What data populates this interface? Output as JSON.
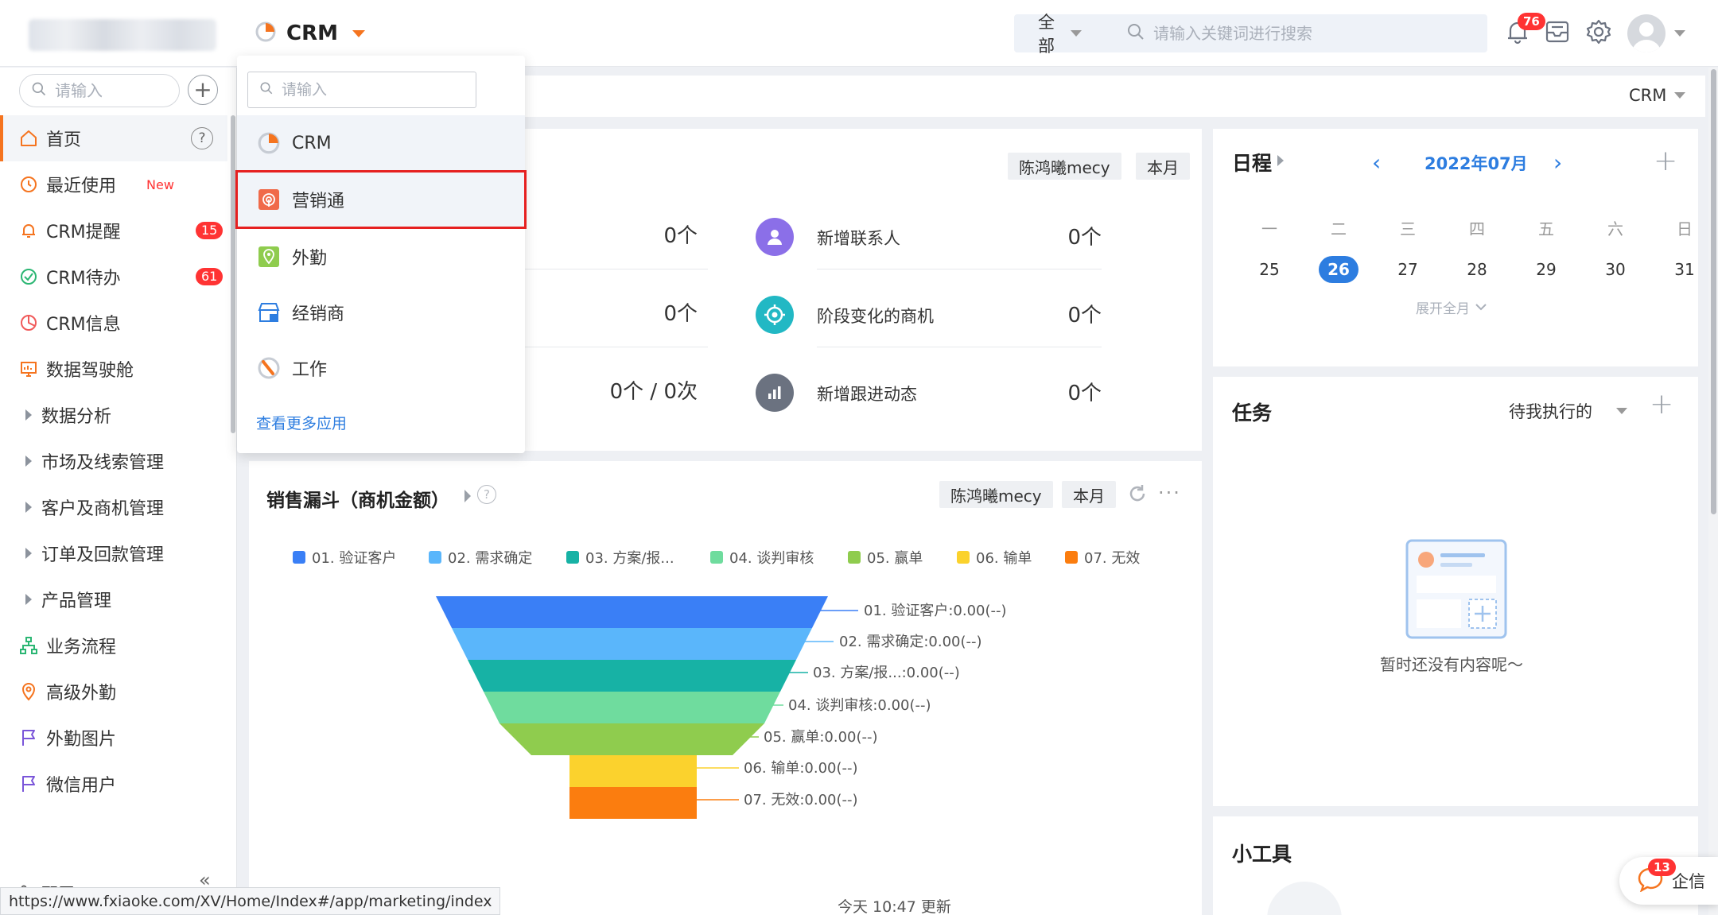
{
  "colors": {
    "brand_orange": "#f5741f",
    "primary_blue": "#2d7de0",
    "badge_red": "#ff3333",
    "highlight_red": "#e62020"
  },
  "topbar": {
    "app_name": "CRM",
    "search_scope": "全部",
    "search_placeholder": "请输入关键词进行搜索",
    "notification_count": "76"
  },
  "sidebar": {
    "search_placeholder": "请输入",
    "items": [
      {
        "label": "首页",
        "icon": "home-icon",
        "active": true
      },
      {
        "label": "最近使用",
        "icon": "clock-icon",
        "tag": "New"
      },
      {
        "label": "CRM提醒",
        "icon": "bell-icon",
        "badge": "15"
      },
      {
        "label": "CRM待办",
        "icon": "check-circle-icon",
        "badge": "61"
      },
      {
        "label": "CRM信息",
        "icon": "pie-icon"
      },
      {
        "label": "数据驾驶舱",
        "icon": "dashboard-icon"
      },
      {
        "label": "数据分析",
        "icon": "expand-arrow-icon"
      },
      {
        "label": "市场及线索管理",
        "icon": "expand-arrow-icon"
      },
      {
        "label": "客户及商机管理",
        "icon": "expand-arrow-icon"
      },
      {
        "label": "订单及回款管理",
        "icon": "expand-arrow-icon"
      },
      {
        "label": "产品管理",
        "icon": "expand-arrow-icon"
      },
      {
        "label": "业务流程",
        "icon": "flow-icon"
      },
      {
        "label": "高级外勤",
        "icon": "location-icon"
      },
      {
        "label": "外勤图片",
        "icon": "flag-icon"
      },
      {
        "label": "微信用户",
        "icon": "flag-icon"
      }
    ],
    "footer_label": "配置"
  },
  "content_bar": {
    "app_select": "CRM"
  },
  "stats": {
    "owner": "陈鸿曦mecy",
    "period": "本月",
    "left_values": [
      "0个",
      "0个",
      "0个 / 0次"
    ],
    "right": [
      {
        "label": "新增联系人",
        "value": "0个",
        "icon": "contact-icon",
        "color": "#8b6fe8"
      },
      {
        "label": "阶段变化的商机",
        "value": "0个",
        "icon": "target-icon",
        "color": "#22b8c4"
      },
      {
        "label": "新增跟进动态",
        "value": "0个",
        "icon": "bar-chart-icon",
        "color": "#6b7280"
      }
    ]
  },
  "funnel": {
    "title": "销售漏斗（商机金额）",
    "owner": "陈鸿曦mecy",
    "period": "本月",
    "updated": "今天 10:47 更新",
    "legend": [
      {
        "label": "01. 验证客户",
        "color": "#3a7ff6"
      },
      {
        "label": "02. 需求确定",
        "color": "#5ab6fb"
      },
      {
        "label": "03. 方案/报...",
        "color": "#17b2a5"
      },
      {
        "label": "04. 谈判审核",
        "color": "#6fdc9e"
      },
      {
        "label": "05. 赢单",
        "color": "#8fcc4e"
      },
      {
        "label": "06. 输单",
        "color": "#fbd22d"
      },
      {
        "label": "07. 无效",
        "color": "#fb7d0f"
      }
    ],
    "labels": [
      "01. 验证客户:0.00(--)",
      "02. 需求确定:0.00(--)",
      "03. 方案/报...:0.00(--)",
      "04. 谈判审核:0.00(--)",
      "05. 赢单:0.00(--)",
      "06. 输单:0.00(--)",
      "07. 无效:0.00(--)"
    ]
  },
  "schedule": {
    "title": "日程",
    "month": "2022年07月",
    "weekdays": [
      "一",
      "二",
      "三",
      "四",
      "五",
      "六",
      "日"
    ],
    "days": [
      "25",
      "26",
      "27",
      "28",
      "29",
      "30",
      "31"
    ],
    "today": "26",
    "expand_label": "展开全月"
  },
  "tasks": {
    "title": "任务",
    "filter": "待我执行的",
    "empty_text": "暂时还没有内容呢～"
  },
  "tools": {
    "title": "小工具"
  },
  "app_dropdown": {
    "search_placeholder": "请输入",
    "items": [
      {
        "label": "CRM",
        "icon": "crm-pie-icon"
      },
      {
        "label": "营销通",
        "icon": "marketing-icon"
      },
      {
        "label": "外勤",
        "icon": "field-work-icon"
      },
      {
        "label": "经销商",
        "icon": "dealer-icon"
      },
      {
        "label": "工作",
        "icon": "work-icon"
      }
    ],
    "more_link": "查看更多应用"
  },
  "status_url": "https://www.fxiaoke.com/XV/Home/Index#/app/marketing/index",
  "qixin": {
    "label": "企信",
    "badge": "13"
  }
}
